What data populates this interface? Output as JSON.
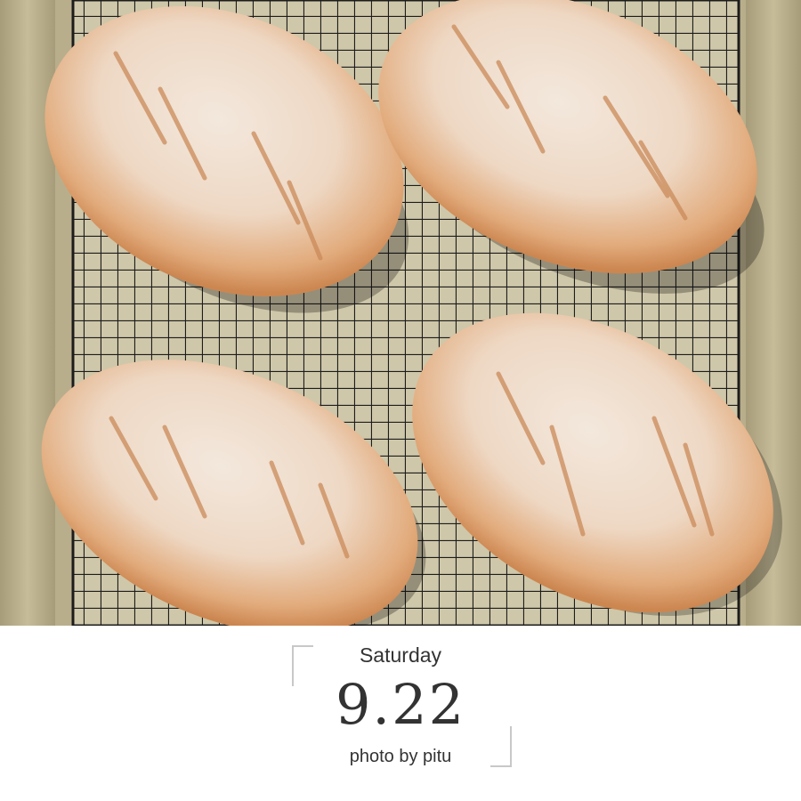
{
  "photo": {
    "subject": "four-loaves-on-cooling-rack",
    "colors": {
      "pan": "#b9ae8c",
      "rack": "#1c1c1c",
      "crust": "#d9945e",
      "flour": "#f1e7dc"
    }
  },
  "caption": {
    "day": "Saturday",
    "date": "9.22",
    "credit": "photo by pitu"
  }
}
